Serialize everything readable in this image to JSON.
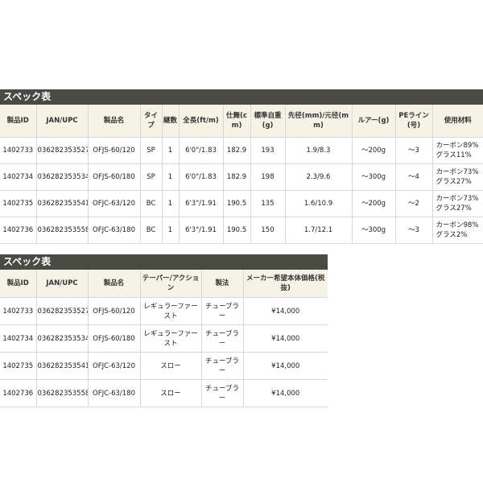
{
  "spec1": {
    "title": "スペック表",
    "headers": [
      "製品ID",
      "JAN/UPC",
      "製品名",
      "タイプ",
      "継数",
      "全長(ft/m)",
      "仕舞(cm)",
      "標準自重(g)",
      "先径(mm)/元径(mm)",
      "ルアー(g)",
      "PEライン(号)",
      "使用材料"
    ],
    "rows": [
      [
        "1402733",
        "036282353527",
        "OFJS-60/120",
        "SP",
        "1",
        "6'0\"/1.83",
        "182.9",
        "193",
        "1.9/8.3",
        "～200g",
        "～3",
        "カーボン89%グラス11%"
      ],
      [
        "1402734",
        "036282353534",
        "OFJS-60/180",
        "SP",
        "1",
        "6'0\"/1.83",
        "182.9",
        "198",
        "2.3/9.6",
        "～300g",
        "～4",
        "カーボン73%グラス27%"
      ],
      [
        "1402735",
        "036282353541",
        "OFJC-63/120",
        "BC",
        "1",
        "6'3\"/1.91",
        "190.5",
        "135",
        "1.6/10.9",
        "～200g",
        "～2",
        "カーボン73%グラス27%"
      ],
      [
        "1402736",
        "036282353558",
        "OFJC-63/180",
        "BC",
        "1",
        "6'3\"/1.91",
        "190.5",
        "150",
        "1.7/12.1",
        "～300g",
        "～3",
        "カーボン98%グラス2%"
      ]
    ]
  },
  "spec2": {
    "title": "スペック表",
    "headers": [
      "製品ID",
      "JAN/UPC",
      "製品名",
      "テーパー/アクション",
      "製法",
      "メーカー希望本体価格(税抜)"
    ],
    "rows": [
      [
        "1402733",
        "036282353527",
        "OFJS-60/120",
        "レギュラーファースト",
        "チューブラー",
        "¥14,000"
      ],
      [
        "1402734",
        "036282353534",
        "OFJS-60/180",
        "レギュラーファースト",
        "チューブラー",
        "¥14,000"
      ],
      [
        "1402735",
        "036282353541",
        "OFJC-63/120",
        "スロー",
        "チューブラー",
        "¥14,000"
      ],
      [
        "1402736",
        "036282353558",
        "OFJC-63/180",
        "スロー",
        "チューブラー",
        "¥14,000"
      ]
    ]
  }
}
